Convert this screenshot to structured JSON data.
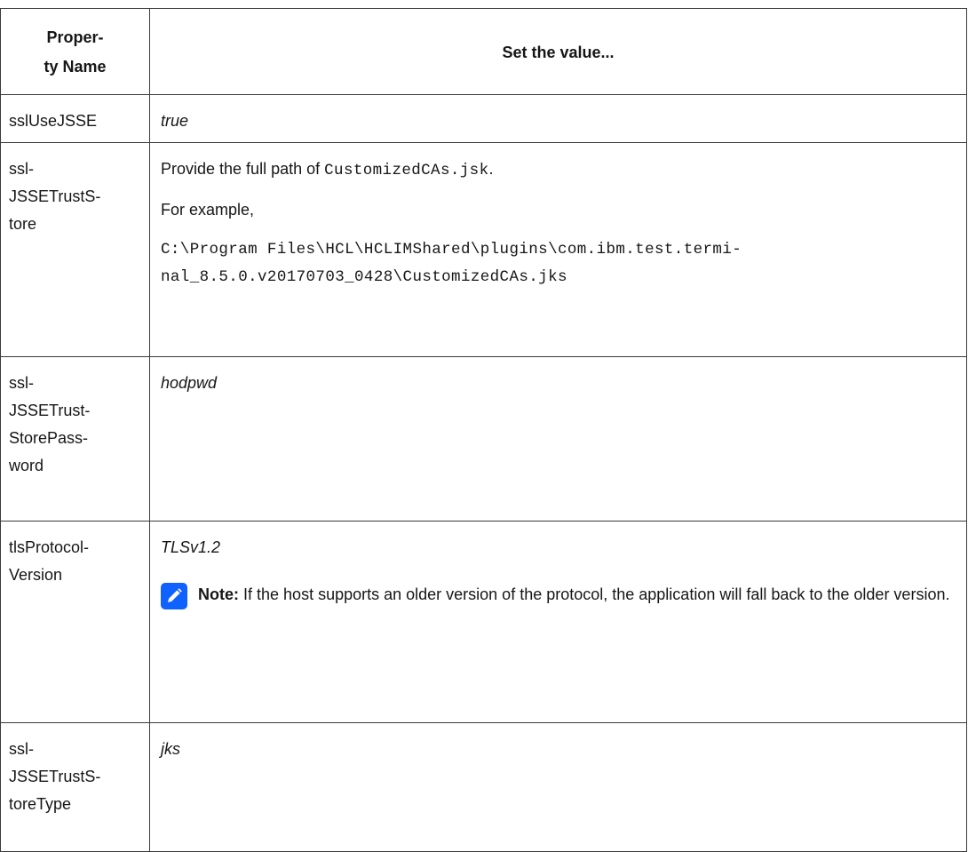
{
  "table": {
    "headers": {
      "property": "Proper-\nty Name",
      "value": "Set the value..."
    },
    "rows": [
      {
        "name": "sslUseJSSE",
        "value": "true"
      },
      {
        "name": "ssl-\nJSSETrustS-\ntore",
        "value_text_before": "Provide the full path of",
        "value_code": "CustomizedCAs.jsk",
        "value_text_after": ".",
        "example_label": "For example,",
        "example_path": "C:\\Program Files\\HCL\\HCLIMShared\\plugins\\com.ibm.test.termi-\nnal_8.5.0.v20170703_0428\\CustomizedCAs.jks"
      },
      {
        "name": "ssl-\nJSSETrust-\nStorePass-\nword",
        "value": "hodpwd"
      },
      {
        "name": "tlsProtocol-\nVersion",
        "value": "TLSv1.2",
        "note": {
          "icon": "pencil-icon",
          "label": "Note:",
          "text": "If the host supports an older version of the protocol, the application will fall back to the older version."
        }
      },
      {
        "name": "ssl-\nJSSETrustS-\ntoreType",
        "value": "jks"
      }
    ]
  },
  "colors": {
    "note_icon": "#0f62fe",
    "border": "#3a3a3a"
  }
}
